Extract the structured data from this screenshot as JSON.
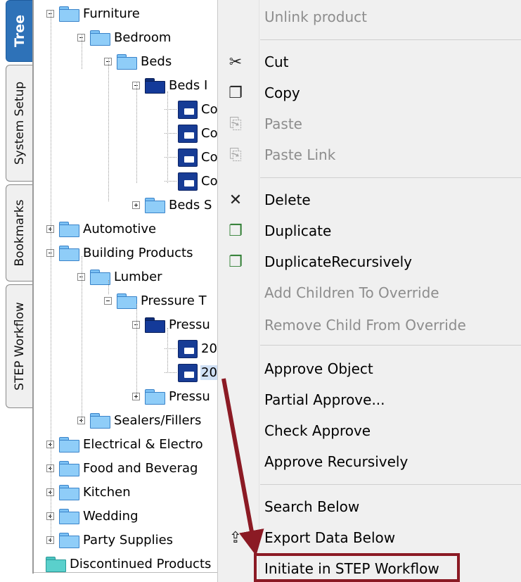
{
  "tabs": [
    {
      "label": "Tree",
      "active": true
    },
    {
      "label": "System Setup",
      "active": false
    },
    {
      "label": "Bookmarks",
      "active": false
    },
    {
      "label": "STEP Workflow",
      "active": false
    }
  ],
  "tree": {
    "rows": [
      {
        "label": "Furniture",
        "icon": "folder",
        "expander": "minus"
      },
      {
        "label": "Bedroom",
        "icon": "folder",
        "expander": "minus"
      },
      {
        "label": "Beds",
        "icon": "folder",
        "expander": "minus"
      },
      {
        "label": "Beds I",
        "icon": "folder-navy",
        "expander": "minus"
      },
      {
        "label": "Co",
        "icon": "product"
      },
      {
        "label": "Co",
        "icon": "product"
      },
      {
        "label": "Co",
        "icon": "product"
      },
      {
        "label": "Co",
        "icon": "product"
      },
      {
        "label": "Beds S",
        "icon": "folder",
        "expander": "plus"
      },
      {
        "label": "Automotive",
        "icon": "folder",
        "expander": "plus"
      },
      {
        "label": "Building Products",
        "icon": "folder",
        "expander": "minus"
      },
      {
        "label": "Lumber",
        "icon": "folder",
        "expander": "minus"
      },
      {
        "label": "Pressure T",
        "icon": "folder",
        "expander": "minus"
      },
      {
        "label": "Pressu",
        "icon": "folder-navy",
        "expander": "minus"
      },
      {
        "label": "20",
        "icon": "product"
      },
      {
        "label": "20",
        "icon": "product",
        "selected": true
      },
      {
        "label": "Pressu",
        "icon": "folder",
        "expander": "plus"
      },
      {
        "label": "Sealers/Fillers",
        "icon": "folder",
        "expander": "plus"
      },
      {
        "label": "Electrical & Electro",
        "icon": "folder",
        "expander": "plus"
      },
      {
        "label": "Food and Beverag",
        "icon": "folder",
        "expander": "plus"
      },
      {
        "label": "Kitchen",
        "icon": "folder",
        "expander": "plus"
      },
      {
        "label": "Wedding",
        "icon": "folder",
        "expander": "plus"
      },
      {
        "label": "Party Supplies",
        "icon": "folder",
        "expander": "plus"
      },
      {
        "label": "Discontinued Products",
        "icon": "folder-teal"
      }
    ]
  },
  "menu": {
    "items": [
      {
        "label": "Unlink product",
        "enabled": false,
        "icon": ""
      },
      {
        "label": "Cut",
        "enabled": true,
        "icon": "scissors-icon"
      },
      {
        "label": "Copy",
        "enabled": true,
        "icon": "copy-icon"
      },
      {
        "label": "Paste",
        "enabled": false,
        "icon": "paste-icon"
      },
      {
        "label": "Paste Link",
        "enabled": false,
        "icon": "paste-link-icon"
      },
      {
        "label": "Delete",
        "enabled": true,
        "icon": "delete-icon"
      },
      {
        "label": "Duplicate",
        "enabled": true,
        "icon": "duplicate-icon"
      },
      {
        "label": "DuplicateRecursively",
        "enabled": true,
        "icon": "duplicate-recursive-icon"
      },
      {
        "label": "Add Children To Override",
        "enabled": false,
        "icon": ""
      },
      {
        "label": "Remove Child From Override",
        "enabled": false,
        "icon": ""
      },
      {
        "label": "Approve Object",
        "enabled": true,
        "icon": ""
      },
      {
        "label": "Partial Approve...",
        "enabled": true,
        "icon": ""
      },
      {
        "label": "Check Approve",
        "enabled": true,
        "icon": ""
      },
      {
        "label": "Approve Recursively",
        "enabled": true,
        "icon": ""
      },
      {
        "label": "Search Below",
        "enabled": true,
        "icon": ""
      },
      {
        "label": "Export Data Below",
        "enabled": true,
        "icon": "export-icon"
      },
      {
        "label": "Initiate in STEP Workflow",
        "enabled": true,
        "icon": "",
        "highlighted": true
      }
    ]
  },
  "annotation": {
    "color": "#8b1a24"
  }
}
